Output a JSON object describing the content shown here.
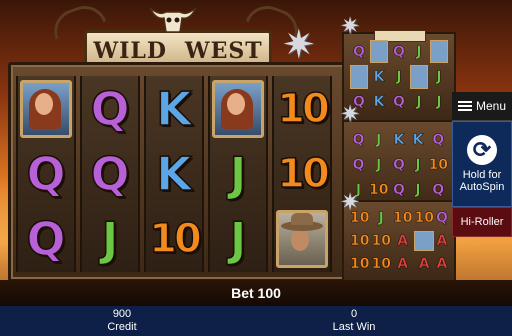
{
  "game": {
    "title_left": "WILD",
    "title_right": "WEST"
  },
  "reels": [
    [
      "portrait-woman",
      "Q",
      "Q"
    ],
    [
      "Q",
      "Q",
      "J"
    ],
    [
      "K",
      "K",
      "10"
    ],
    [
      "portrait-woman",
      "J",
      "J"
    ],
    [
      "10",
      "10",
      "portrait-cowboy"
    ]
  ],
  "mini_machines": [
    {
      "grid": [
        "Q",
        "P",
        "Q",
        "J",
        "P",
        "P",
        "K",
        "J",
        "P",
        "J",
        "Q",
        "K",
        "Q",
        "J",
        "J"
      ]
    },
    {
      "grid": [
        "Q",
        "J",
        "K",
        "K",
        "Q",
        "Q",
        "J",
        "Q",
        "J",
        "10",
        "J",
        "10",
        "Q",
        "J",
        "Q"
      ]
    },
    {
      "grid": [
        "10",
        "J",
        "10",
        "10",
        "Q",
        "10",
        "10",
        "A",
        "P",
        "A",
        "10",
        "10",
        "A",
        "A",
        "A"
      ]
    }
  ],
  "side_panel": {
    "menu_label": "Menu",
    "autospin_label": "Hold for AutoSpin",
    "hiroller_label": "Hi-Roller"
  },
  "bet": {
    "label": "Bet 100"
  },
  "credit": {
    "value": "900",
    "label": "Credit"
  },
  "last_win": {
    "value": "0",
    "label": "Last Win"
  },
  "icons": {
    "menu": "hamburger-icon",
    "autospin": "circular-arrow-icon",
    "sheriff": "star-badge-icon",
    "skull": "bull-skull-icon"
  },
  "colors": {
    "Q": "#b860d8",
    "K": "#5aa6e6",
    "J": "#6cc844",
    "10": "#f28a1e",
    "A": "#e04040",
    "info_bar": "#0e2048"
  }
}
